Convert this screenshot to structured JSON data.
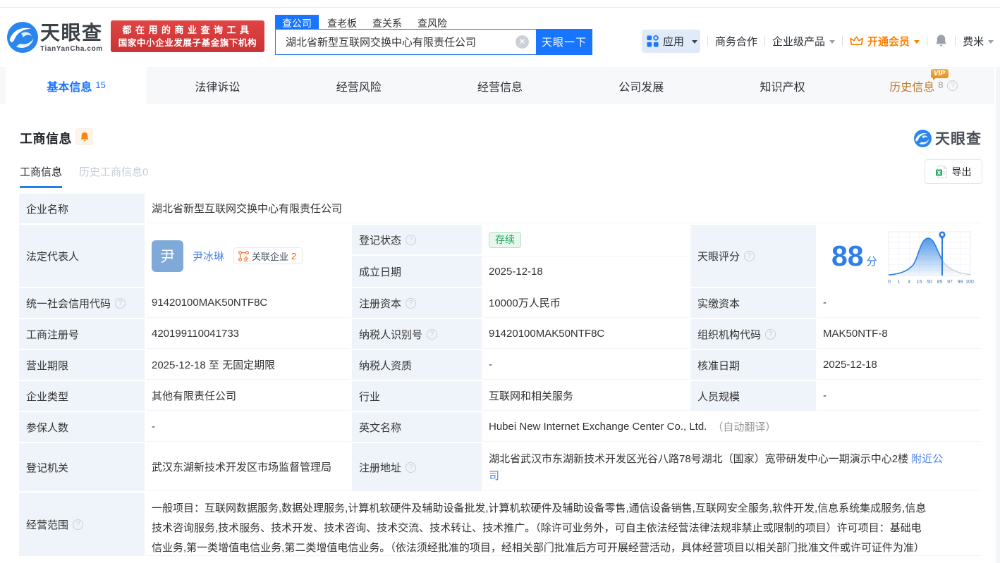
{
  "brand": {
    "logo_text": "天眼查",
    "logo_domain": "TianYanCha.com",
    "slogan_line1": "都在用的商业查询工具",
    "slogan_line2": "国家中小企业发展子基金旗下机构"
  },
  "search": {
    "tabs": [
      "查公司",
      "查老板",
      "查关系",
      "查风险"
    ],
    "value": "湖北省新型互联网交换中心有限责任公司",
    "button_label": "天眼一下"
  },
  "topnav": {
    "apps_label": "应用",
    "business_coop": "商务合作",
    "enterprise_product": "企业级产品",
    "vip_label": "开通会员",
    "user_name": "费米"
  },
  "nav_tabs": {
    "t0": {
      "label": "基本信息",
      "count": "15"
    },
    "t1": {
      "label": "法律诉讼"
    },
    "t2": {
      "label": "经营风险"
    },
    "t3": {
      "label": "经营信息"
    },
    "t4": {
      "label": "公司发展"
    },
    "t5": {
      "label": "知识产权"
    },
    "t6": {
      "label": "历史信息",
      "count": "8",
      "vip": "VIP"
    }
  },
  "section": {
    "title": "工商信息",
    "tab_current": "工商信息",
    "tab_history": "历史工商信息0",
    "export_label": "导出",
    "watermark_text": "天眼查"
  },
  "table": {
    "company_name": {
      "label": "企业名称",
      "value": "湖北省新型互联网交换中心有限责任公司"
    },
    "legal_rep": {
      "label": "法定代表人",
      "avatar": "尹",
      "name": "尹冰琳",
      "rel_label": "关联企业",
      "rel_count": "2"
    },
    "reg_status": {
      "label": "登记状态",
      "value": "存续"
    },
    "establish_date": {
      "label": "成立日期",
      "value": "2025-12-18"
    },
    "score": {
      "label": "天眼评分",
      "value": "88",
      "unit": "分"
    },
    "credit_code": {
      "label": "统一社会信用代码",
      "value": "91420100MAK50NTF8C"
    },
    "reg_capital": {
      "label": "注册资本",
      "value": "10000万人民币"
    },
    "paid_capital": {
      "label": "实缴资本",
      "value": "-"
    },
    "reg_number": {
      "label": "工商注册号",
      "value": "420199110041733"
    },
    "taxpayer_id": {
      "label": "纳税人识别号",
      "value": "91420100MAK50NTF8C"
    },
    "org_code": {
      "label": "组织机构代码",
      "value": "MAK50NTF-8"
    },
    "business_term": {
      "label": "营业期限",
      "value": "2025-12-18 至 无固定期限"
    },
    "taxpayer_quality": {
      "label": "纳税人资质",
      "value": "-"
    },
    "approval_date": {
      "label": "核准日期",
      "value": "2025-12-18"
    },
    "company_type": {
      "label": "企业类型",
      "value": "其他有限责任公司"
    },
    "industry": {
      "label": "行业",
      "value": "互联网和相关服务"
    },
    "staff_size": {
      "label": "人员规模",
      "value": "-"
    },
    "insured_count": {
      "label": "参保人数",
      "value": "-"
    },
    "english_name": {
      "label": "英文名称",
      "value": "Hubei New Internet Exchange Center Co., Ltd.",
      "note": "（自动翻译）"
    },
    "reg_authority": {
      "label": "登记机关",
      "value": "武汉东湖新技术开发区市场监督管理局"
    },
    "reg_address": {
      "label": "注册地址",
      "value": "湖北省武汉市东湖新技术开发区光谷八路78号湖北（国家）宽带研发中心一期演示中心2楼",
      "link": "附近公司"
    },
    "business_scope": {
      "label": "经营范围",
      "value": "一般项目：互联网数据服务,数据处理服务,计算机软硬件及辅助设备批发,计算机软硬件及辅助设备零售,通信设备销售,互联网安全服务,软件开发,信息系统集成服务,信息技术咨询服务,技术服务、技术开发、技术咨询、技术交流、技术转让、技术推广。（除许可业务外，可自主依法经营法律法规非禁止或限制的项目）许可项目：基础电信业务,第一类增值电信业务,第二类增值电信业务。（依法须经批准的项目，经相关部门批准后方可开展经营活动，具体经营项目以相关部门批准文件或许可证件为准）"
    }
  },
  "chart_data": {
    "type": "area",
    "title": "天眼评分分布曲线",
    "x_ticks": [
      "0",
      "1",
      "3",
      "15",
      "50",
      "85",
      "97",
      "99",
      "100"
    ],
    "marker_value": 88,
    "score": 88,
    "curve_peak_tick": "50",
    "accent_color": "#2f7de0"
  },
  "colors": {
    "accent_blue": "#1775ff",
    "link_blue": "#4e83e8",
    "label_cell_bg": "#eff4fa",
    "status_green": "#21a45d",
    "vip_orange": "#ff8000",
    "banner_red": "#d83b3b"
  }
}
